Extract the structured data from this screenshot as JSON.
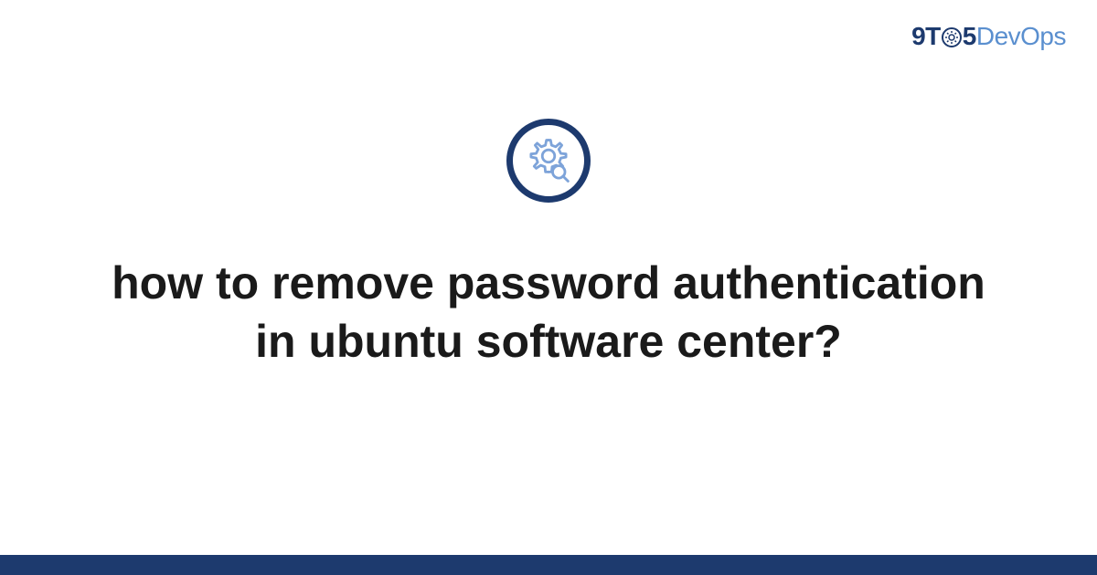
{
  "brand": {
    "part1": "9T",
    "part2": "5",
    "part3": "Dev",
    "part4": "Ops"
  },
  "title": "how to remove password authentication in ubuntu software center?",
  "colors": {
    "primary": "#1d3a6e",
    "accent": "#5a8fcf",
    "icon_light": "#7da3d9"
  }
}
